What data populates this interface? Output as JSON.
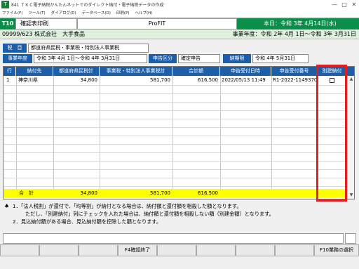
{
  "window": {
    "icon_label": "T",
    "title": "841 ＴＫＣ電子納税かんたんネットでのダイレクト納付・電子納税データの作成",
    "controls": [
      "—",
      "□",
      "✕"
    ]
  },
  "menu": [
    "ファイル(F)",
    "ツール(T)",
    "ダイアログ(D)",
    "データベース(D)",
    "印刷(P)",
    "ヘルプ(H)"
  ],
  "header": {
    "code": "T10",
    "title": "確認表印刷",
    "center": "ProFIT",
    "today": "本日：令和 3年 4月14日(水)"
  },
  "company": {
    "name": "09999/623 株式会社　大手食品",
    "fiscal_year": "事業年度：令和 2年 4月 1日～令和 3年 3月31日"
  },
  "info": {
    "tax_label": "税　目",
    "tax_value": "都道府県民税・事業税・特別法人事業税",
    "year_label": "事業年度",
    "year_value": "令和 3年 4月 1日～令和 4年 3月31日",
    "kubun_label": "申告区分",
    "kubun_value": "確定申告",
    "deadline_label": "納期限",
    "deadline_value": "令和 4年 5月31日"
  },
  "table": {
    "headers": [
      "行",
      "納付先",
      "都道府県民税計",
      "事業税・特別法人事業税計",
      "合計額",
      "申告受付日時",
      "申告受付番号",
      "別建納付"
    ],
    "rows": [
      {
        "row": "1",
        "payee": "神奈川県",
        "prefectural_tax": "34,800",
        "business_tax": "581,700",
        "total": "616,500",
        "received_at": "2022/05/13 11:49",
        "receipt_no": "R1-2022-1149370"
      }
    ],
    "total_label": "合　計",
    "total_prefectural": "34,800",
    "total_business": "581,700",
    "total_sum": "616,500"
  },
  "notes": {
    "line1": "1．「法人税割」が還付で、「均等割」が納付となる場合は、納付額と還付額を相殺した額となります。",
    "line2": "ただし、「別建納付」列にチェックを入れた場合は、納付額と還付額を相殺しない額（別建金額）となります。",
    "line3": "2．見込納付額がある場合、見込納付額を控除した額となります。"
  },
  "fkeys": {
    "f4": "F4確認終了",
    "f10": "F10業務の選択"
  },
  "colors": {
    "accent_green": "#0b8e4a",
    "header_blue": "#1c5fa8",
    "total_yellow": "#ffff00",
    "highlight_red": "#e02020"
  }
}
